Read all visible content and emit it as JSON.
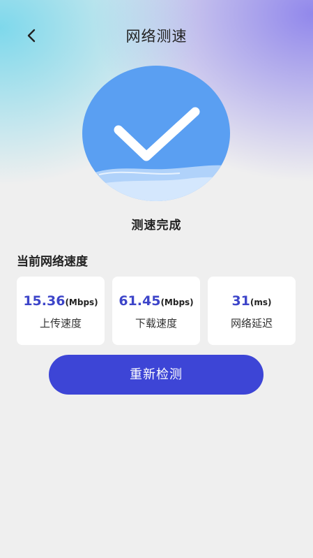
{
  "header": {
    "title": "网络测速",
    "back_icon": "chevron-left-icon"
  },
  "result": {
    "icon": "checkmark-icon",
    "status": "测速完成"
  },
  "section": {
    "title": "当前网络速度"
  },
  "metrics": [
    {
      "value": "15.36",
      "unit": "(Mbps)",
      "label": "上传速度"
    },
    {
      "value": "61.45",
      "unit": "(Mbps)",
      "label": "下载速度"
    },
    {
      "value": "31",
      "unit": "(ms)",
      "label": "网络延迟"
    }
  ],
  "actions": {
    "retest_label": "重新检测"
  },
  "colors": {
    "accent": "#3d45d6",
    "value_text": "#3d45c9",
    "circle": "#5a9ff2"
  }
}
